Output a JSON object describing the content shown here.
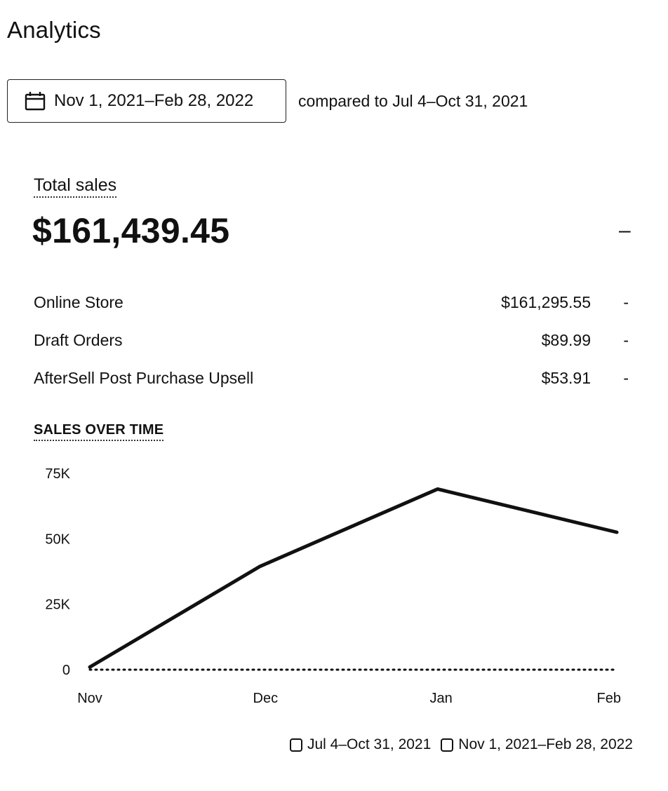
{
  "page": {
    "title": "Analytics"
  },
  "date_filter": {
    "range_label": "Nov 1, 2021–Feb 28, 2022",
    "compare_label": "compared to Jul 4–Oct 31, 2021",
    "icon": "calendar-icon"
  },
  "total_sales": {
    "label": "Total sales",
    "value": "$161,439.45",
    "change": "–"
  },
  "breakdown": [
    {
      "name": "Online Store",
      "amount": "$161,295.55",
      "change": "-"
    },
    {
      "name": "Draft Orders",
      "amount": "$89.99",
      "change": "-"
    },
    {
      "name": "AfterSell Post Purchase Upsell",
      "amount": "$53.91",
      "change": "-"
    }
  ],
  "chart_section": {
    "title": "SALES OVER TIME"
  },
  "legend": [
    {
      "label": "Jul 4–Oct 31, 2021"
    },
    {
      "label": "Nov 1, 2021–Feb 28, 2022"
    }
  ],
  "chart_data": {
    "type": "line",
    "categories": [
      "Nov",
      "Dec",
      "Jan",
      "Feb"
    ],
    "y_ticks": [
      "0",
      "25K",
      "50K",
      "75K"
    ],
    "ylim": [
      0,
      75000
    ],
    "grid": false,
    "legend_position": "bottom-right",
    "series": [
      {
        "name": "Nov 1, 2021–Feb 28, 2022",
        "style": "solid",
        "x": [
          0,
          0.97,
          1.98,
          3.0
        ],
        "values": [
          1000,
          39500,
          69000,
          52500
        ]
      },
      {
        "name": "Jul 4–Oct 31, 2021",
        "style": "dotted",
        "x": [
          0,
          3.0
        ],
        "values": [
          0,
          0
        ]
      }
    ]
  }
}
